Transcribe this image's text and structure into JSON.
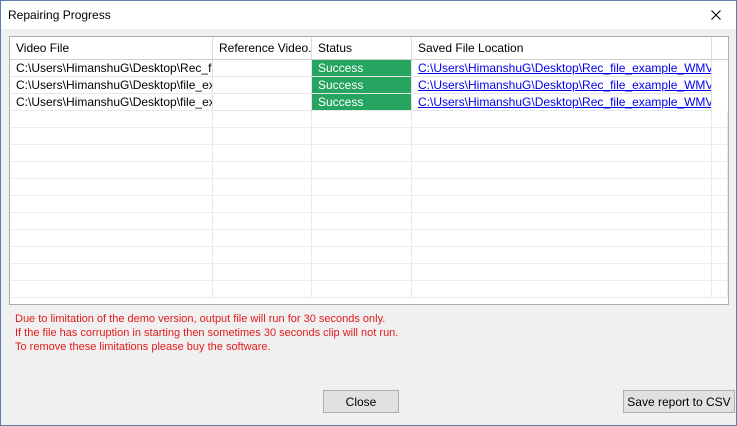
{
  "window": {
    "title": "Repairing Progress",
    "close_icon": "close-icon"
  },
  "table": {
    "columns": [
      "Video File",
      "Reference Video...",
      "Status",
      "Saved File Location"
    ],
    "rows": [
      {
        "video_file": "C:\\Users\\HimanshuG\\Desktop\\Rec_fil...",
        "reference_video": "",
        "status": "Success",
        "saved_location": "C:\\Users\\HimanshuG\\Desktop\\Rec_file_example_WMV_..."
      },
      {
        "video_file": "C:\\Users\\HimanshuG\\Desktop\\file_ex...",
        "reference_video": "",
        "status": "Success",
        "saved_location": "C:\\Users\\HimanshuG\\Desktop\\Rec_file_example_WMV_..."
      },
      {
        "video_file": "C:\\Users\\HimanshuG\\Desktop\\file_ex...",
        "reference_video": "",
        "status": "Success",
        "saved_location": "C:\\Users\\HimanshuG\\Desktop\\Rec_file_example_WMV_..."
      }
    ],
    "status_color": "#25a55f",
    "link_color": "#0000ee"
  },
  "notes": [
    "Due to limitation of the demo version, output file will run for 30 seconds only.",
    "If the file has corruption in starting then sometimes 30 seconds clip will not run.",
    "To remove these limitations please buy the software."
  ],
  "notes_color": "#e01b1b",
  "buttons": {
    "close": "Close",
    "save_csv": "Save report to CSV"
  }
}
